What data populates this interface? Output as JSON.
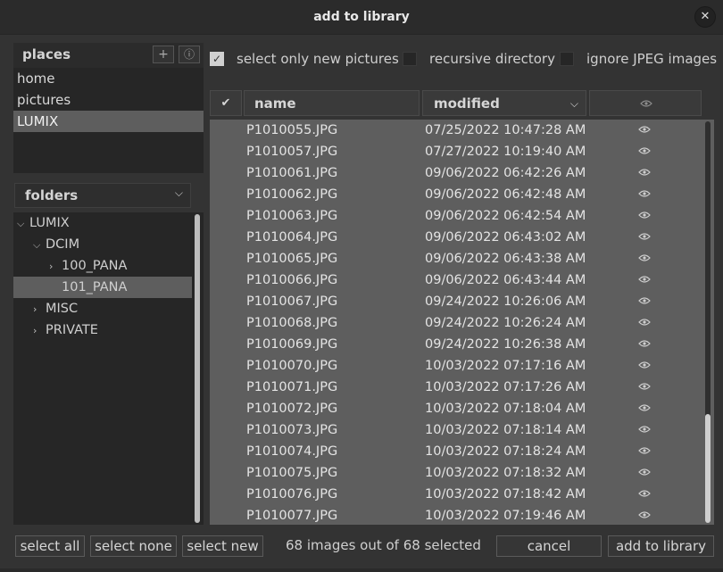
{
  "window": {
    "title": "add to library",
    "close_glyph": "✕"
  },
  "places": {
    "title": "places",
    "add_glyph": "+",
    "info_glyph": "ⓘ",
    "items": [
      {
        "label": "home",
        "selected": false
      },
      {
        "label": "pictures",
        "selected": false
      },
      {
        "label": "LUMIX",
        "selected": true
      }
    ]
  },
  "folders": {
    "label": "folders",
    "chevron": "⌵",
    "tree": [
      {
        "label": "LUMIX",
        "depth": 0,
        "expanded": true,
        "selected": false,
        "has_children": true
      },
      {
        "label": "DCIM",
        "depth": 1,
        "expanded": true,
        "selected": false,
        "has_children": true
      },
      {
        "label": "100_PANA",
        "depth": 2,
        "expanded": false,
        "selected": false,
        "has_children": true
      },
      {
        "label": "101_PANA",
        "depth": 2,
        "expanded": false,
        "selected": true,
        "has_children": false
      },
      {
        "label": "MISC",
        "depth": 1,
        "expanded": false,
        "selected": false,
        "has_children": true
      },
      {
        "label": "PRIVATE",
        "depth": 1,
        "expanded": false,
        "selected": false,
        "has_children": true
      }
    ]
  },
  "options": {
    "select_only_new": {
      "label": "select only new pictures",
      "checked": true
    },
    "recursive": {
      "label": "recursive directory",
      "checked": false
    },
    "ignore_jpeg": {
      "label": "ignore JPEG images",
      "checked": false
    }
  },
  "table": {
    "check_header": "✔",
    "name_header": "name",
    "modified_header": "modified",
    "sort_chevron": "⌵",
    "rows": [
      {
        "name": "P1010055.JPG",
        "modified": "07/25/2022 10:47:28 AM"
      },
      {
        "name": "P1010057.JPG",
        "modified": "07/27/2022 10:19:40 AM"
      },
      {
        "name": "P1010061.JPG",
        "modified": "09/06/2022 06:42:26 AM"
      },
      {
        "name": "P1010062.JPG",
        "modified": "09/06/2022 06:42:48 AM"
      },
      {
        "name": "P1010063.JPG",
        "modified": "09/06/2022 06:42:54 AM"
      },
      {
        "name": "P1010064.JPG",
        "modified": "09/06/2022 06:43:02 AM"
      },
      {
        "name": "P1010065.JPG",
        "modified": "09/06/2022 06:43:38 AM"
      },
      {
        "name": "P1010066.JPG",
        "modified": "09/06/2022 06:43:44 AM"
      },
      {
        "name": "P1010067.JPG",
        "modified": "09/24/2022 10:26:06 AM"
      },
      {
        "name": "P1010068.JPG",
        "modified": "09/24/2022 10:26:24 AM"
      },
      {
        "name": "P1010069.JPG",
        "modified": "09/24/2022 10:26:38 AM"
      },
      {
        "name": "P1010070.JPG",
        "modified": "10/03/2022 07:17:16 AM"
      },
      {
        "name": "P1010071.JPG",
        "modified": "10/03/2022 07:17:26 AM"
      },
      {
        "name": "P1010072.JPG",
        "modified": "10/03/2022 07:18:04 AM"
      },
      {
        "name": "P1010073.JPG",
        "modified": "10/03/2022 07:18:14 AM"
      },
      {
        "name": "P1010074.JPG",
        "modified": "10/03/2022 07:18:24 AM"
      },
      {
        "name": "P1010075.JPG",
        "modified": "10/03/2022 07:18:32 AM"
      },
      {
        "name": "P1010076.JPG",
        "modified": "10/03/2022 07:18:42 AM"
      },
      {
        "name": "P1010077.JPG",
        "modified": "10/03/2022 07:19:46 AM"
      }
    ]
  },
  "footer": {
    "select_all": "select all",
    "select_none": "select none",
    "select_new": "select new",
    "status": "68 images out of 68 selected",
    "cancel": "cancel",
    "add": "add to library"
  },
  "colors": {
    "background": "#333333",
    "selected_row": "#5e5e5e",
    "panel": "#262626"
  }
}
